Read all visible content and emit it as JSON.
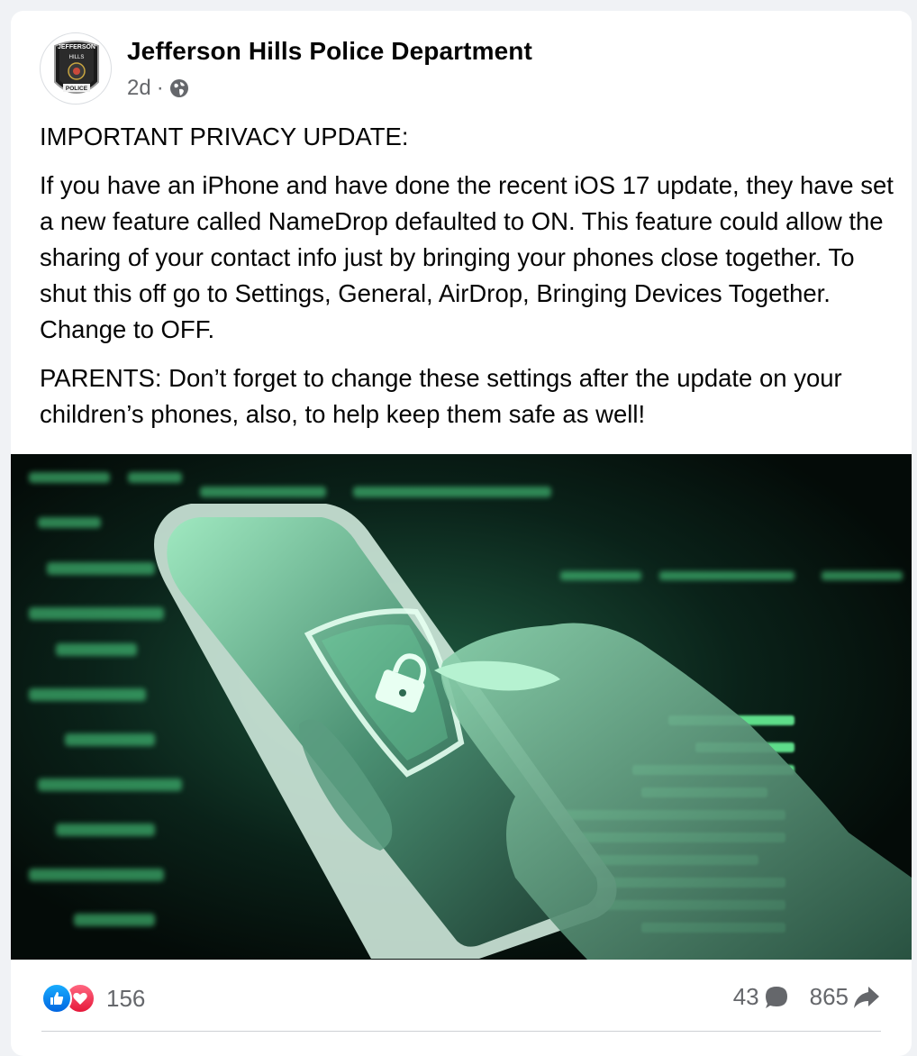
{
  "post": {
    "author": "Jefferson Hills Police Department",
    "time": "2d",
    "separator": "·",
    "audience_icon": "globe-icon",
    "paragraphs": [
      "IMPORTANT PRIVACY UPDATE:",
      "If you have an iPhone and have done the recent iOS 17 update, they have set a new feature called NameDrop defaulted to ON. This feature could allow the sharing of your contact info just by bringing your phones close together.  To shut this off go to Settings, General, AirDrop, Bringing Devices Together. Change to OFF.",
      "PARENTS:  Don’t forget to change these settings after the update on your children’s phones, also, to help keep them safe as well!"
    ],
    "badge": {
      "top_text": "JEFFERSON",
      "mid_text": "HILLS",
      "bottom_text": "POLICE"
    }
  },
  "stats": {
    "reactions_count": "156",
    "reaction_icons": [
      "like-icon",
      "love-icon"
    ],
    "comments_count": "43",
    "shares_count": "865"
  },
  "colors": {
    "accent_like": "#0866ff",
    "accent_love": "#f33e58",
    "secondary_text": "#65676b",
    "hero_green": "#5dff9e"
  }
}
